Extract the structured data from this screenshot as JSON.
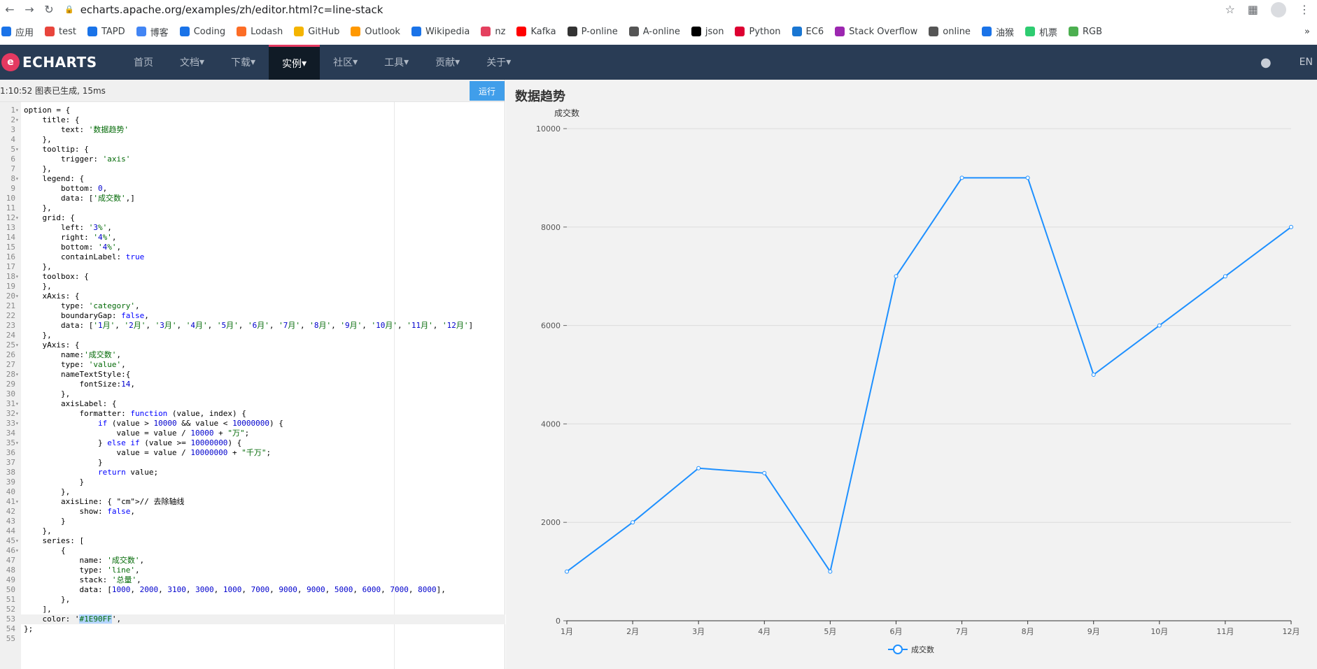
{
  "browser": {
    "url": "echarts.apache.org/examples/zh/editor.html?c=line-stack",
    "bookmarks": [
      "应用",
      "test",
      "TAPD",
      "博客",
      "Coding",
      "Lodash",
      "GitHub",
      "Outlook",
      "Wikipedia",
      "nz",
      "Kafka",
      "P-online",
      "A-online",
      "json",
      "Python",
      "EC6",
      "Stack Overflow",
      "online",
      "油猴",
      "机票",
      "RGB"
    ],
    "overflow_label": "»"
  },
  "header": {
    "logo_text": "ECHARTS",
    "menu": [
      {
        "label": "首页"
      },
      {
        "label": "文档"
      },
      {
        "label": "下载"
      },
      {
        "label": "实例"
      },
      {
        "label": "社区"
      },
      {
        "label": "工具"
      },
      {
        "label": "贡献"
      },
      {
        "label": "关于"
      }
    ],
    "lang_label": "EN"
  },
  "editor": {
    "status": "1:10:52   图表已生成, 15ms",
    "run_label": "运行",
    "lines": [
      "option = {",
      "    title: {",
      "        text: '数据趋势'",
      "    },",
      "    tooltip: {",
      "        trigger: 'axis'",
      "    },",
      "    legend: {",
      "        bottom: 0,",
      "        data: ['成交数',]",
      "    },",
      "    grid: {",
      "        left: '3%',",
      "        right: '4%',",
      "        bottom: '4%',",
      "        containLabel: true",
      "    },",
      "    toolbox: {",
      "    },",
      "    xAxis: {",
      "        type: 'category',",
      "        boundaryGap: false,",
      "        data: ['1月', '2月', '3月', '4月', '5月', '6月', '7月', '8月', '9月', '10月', '11月', '12月']",
      "    },",
      "    yAxis: {",
      "        name:'成交数',",
      "        type: 'value',",
      "        nameTextStyle:{",
      "            fontSize:14,",
      "        },",
      "        axisLabel: {",
      "            formatter: function (value, index) {",
      "                if (value > 10000 && value < 10000000) {",
      "                    value = value / 10000 + \"万\";",
      "                } else if (value >= 10000000) {",
      "                    value = value / 10000000 + \"千万\";",
      "                }",
      "                return value;",
      "            }",
      "        },",
      "        axisLine: { // 去除轴线",
      "            show: false,",
      "        }",
      "    },",
      "    series: [",
      "        {",
      "            name: '成交数',",
      "            type: 'line',",
      "            stack: '总量',",
      "            data: [1000, 2000, 3100, 3000, 1000, 7000, 9000, 9000, 5000, 6000, 7000, 8000],",
      "        },",
      "    ],",
      "    color: '#1E90FF',",
      "};",
      ""
    ],
    "fold_lines": [
      1,
      2,
      5,
      8,
      12,
      18,
      20,
      25,
      28,
      31,
      32,
      33,
      35,
      41,
      45,
      46
    ]
  },
  "chart_data": {
    "type": "line",
    "title": "数据趋势",
    "ylabel": "成交数",
    "categories": [
      "1月",
      "2月",
      "3月",
      "4月",
      "5月",
      "6月",
      "7月",
      "8月",
      "9月",
      "10月",
      "11月",
      "12月"
    ],
    "series": [
      {
        "name": "成交数",
        "values": [
          1000,
          2000,
          3100,
          3000,
          1000,
          7000,
          9000,
          9000,
          5000,
          6000,
          7000,
          8000
        ]
      }
    ],
    "ylim": [
      0,
      10000
    ],
    "yticks": [
      "0",
      "2000",
      "4000",
      "6000",
      "8000",
      "10000"
    ],
    "grid": true,
    "legend_position": "bottom",
    "color": "#1E90FF"
  }
}
